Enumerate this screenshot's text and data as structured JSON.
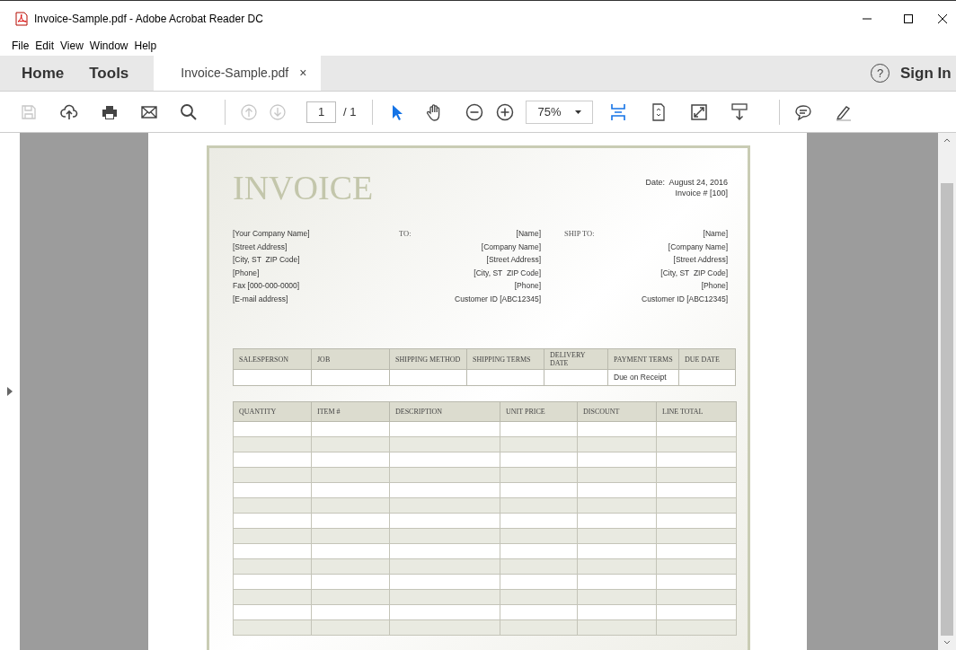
{
  "window": {
    "title": "Invoice-Sample.pdf - Adobe Acrobat Reader DC"
  },
  "menu": [
    "File",
    "Edit",
    "View",
    "Window",
    "Help"
  ],
  "nav": {
    "home": "Home",
    "tools": "Tools",
    "tab": {
      "label": "Invoice-Sample.pdf",
      "close": "×",
      "selected": true
    },
    "help": "?",
    "sign_in": "Sign In"
  },
  "toolbar": {
    "tools": [
      {
        "kind": "save",
        "disabled": true
      },
      {
        "kind": "upload",
        "disabled": false
      },
      {
        "kind": "print",
        "disabled": false
      },
      {
        "kind": "mail",
        "disabled": false
      },
      {
        "kind": "search",
        "disabled": false
      },
      {
        "kind": "sep"
      },
      {
        "kind": "up",
        "disabled": true
      },
      {
        "kind": "down",
        "disabled": true
      },
      {
        "kind": "page"
      },
      {
        "kind": "sep"
      },
      {
        "kind": "pointer",
        "disabled": false
      },
      {
        "kind": "hand",
        "disabled": false
      },
      {
        "kind": "zoomout",
        "disabled": false
      },
      {
        "kind": "zoomin",
        "disabled": false
      },
      {
        "kind": "zoom"
      },
      {
        "kind": "fit",
        "disabled": false
      },
      {
        "kind": "rotate",
        "disabled": false
      },
      {
        "kind": "fullscreen",
        "disabled": false
      },
      {
        "kind": "scroll",
        "disabled": false
      },
      {
        "kind": "sep"
      },
      {
        "kind": "comment",
        "disabled": false
      },
      {
        "kind": "sign",
        "disabled": false
      }
    ],
    "page_number": "1",
    "page_total": "/ 1",
    "zoom": "75%"
  },
  "invoice": {
    "title": "INVOICE",
    "date": "Date:  August 24, 2016",
    "number": "Invoice # [100]",
    "from": [
      "[Your Company Name]",
      "[Street Address]",
      "[City, ST  ZIP Code]",
      "[Phone]",
      "Fax [000-000-0000]",
      "[E-mail address]"
    ],
    "to_label": "TO:",
    "to": [
      "[Name]",
      "[Company Name]",
      "[Street Address]",
      "[City, ST  ZIP Code]",
      "[Phone]",
      "Customer ID [ABC12345]"
    ],
    "ship_label": "SHIP TO:",
    "ship_to": [
      "[Name]",
      "[Company Name]",
      "[Street Address]",
      "[City, ST  ZIP Code]",
      "[Phone]",
      "Customer ID [ABC12345]"
    ],
    "order_table": {
      "columns": [
        "SALESPERSON",
        "JOB",
        "SHIPPING METHOD",
        "SHIPPING TERMS",
        "DELIVERY DATE",
        "PAYMENT TERMS",
        "DUE DATE"
      ],
      "payment_terms": "Due on Receipt"
    },
    "items_table": {
      "columns": [
        "QUANTITY",
        "ITEM #",
        "DESCRIPTION",
        "UNIT PRICE",
        "DISCOUNT",
        "LINE TOTAL"
      ],
      "rows": [
        {
          "shaded": false
        },
        {
          "shaded": true
        },
        {
          "shaded": false
        },
        {
          "shaded": true
        },
        {
          "shaded": false
        },
        {
          "shaded": true
        },
        {
          "shaded": false
        },
        {
          "shaded": true
        },
        {
          "shaded": false
        },
        {
          "shaded": true
        },
        {
          "shaded": false
        },
        {
          "shaded": true
        },
        {
          "shaded": false
        },
        {
          "shaded": true
        }
      ]
    }
  }
}
